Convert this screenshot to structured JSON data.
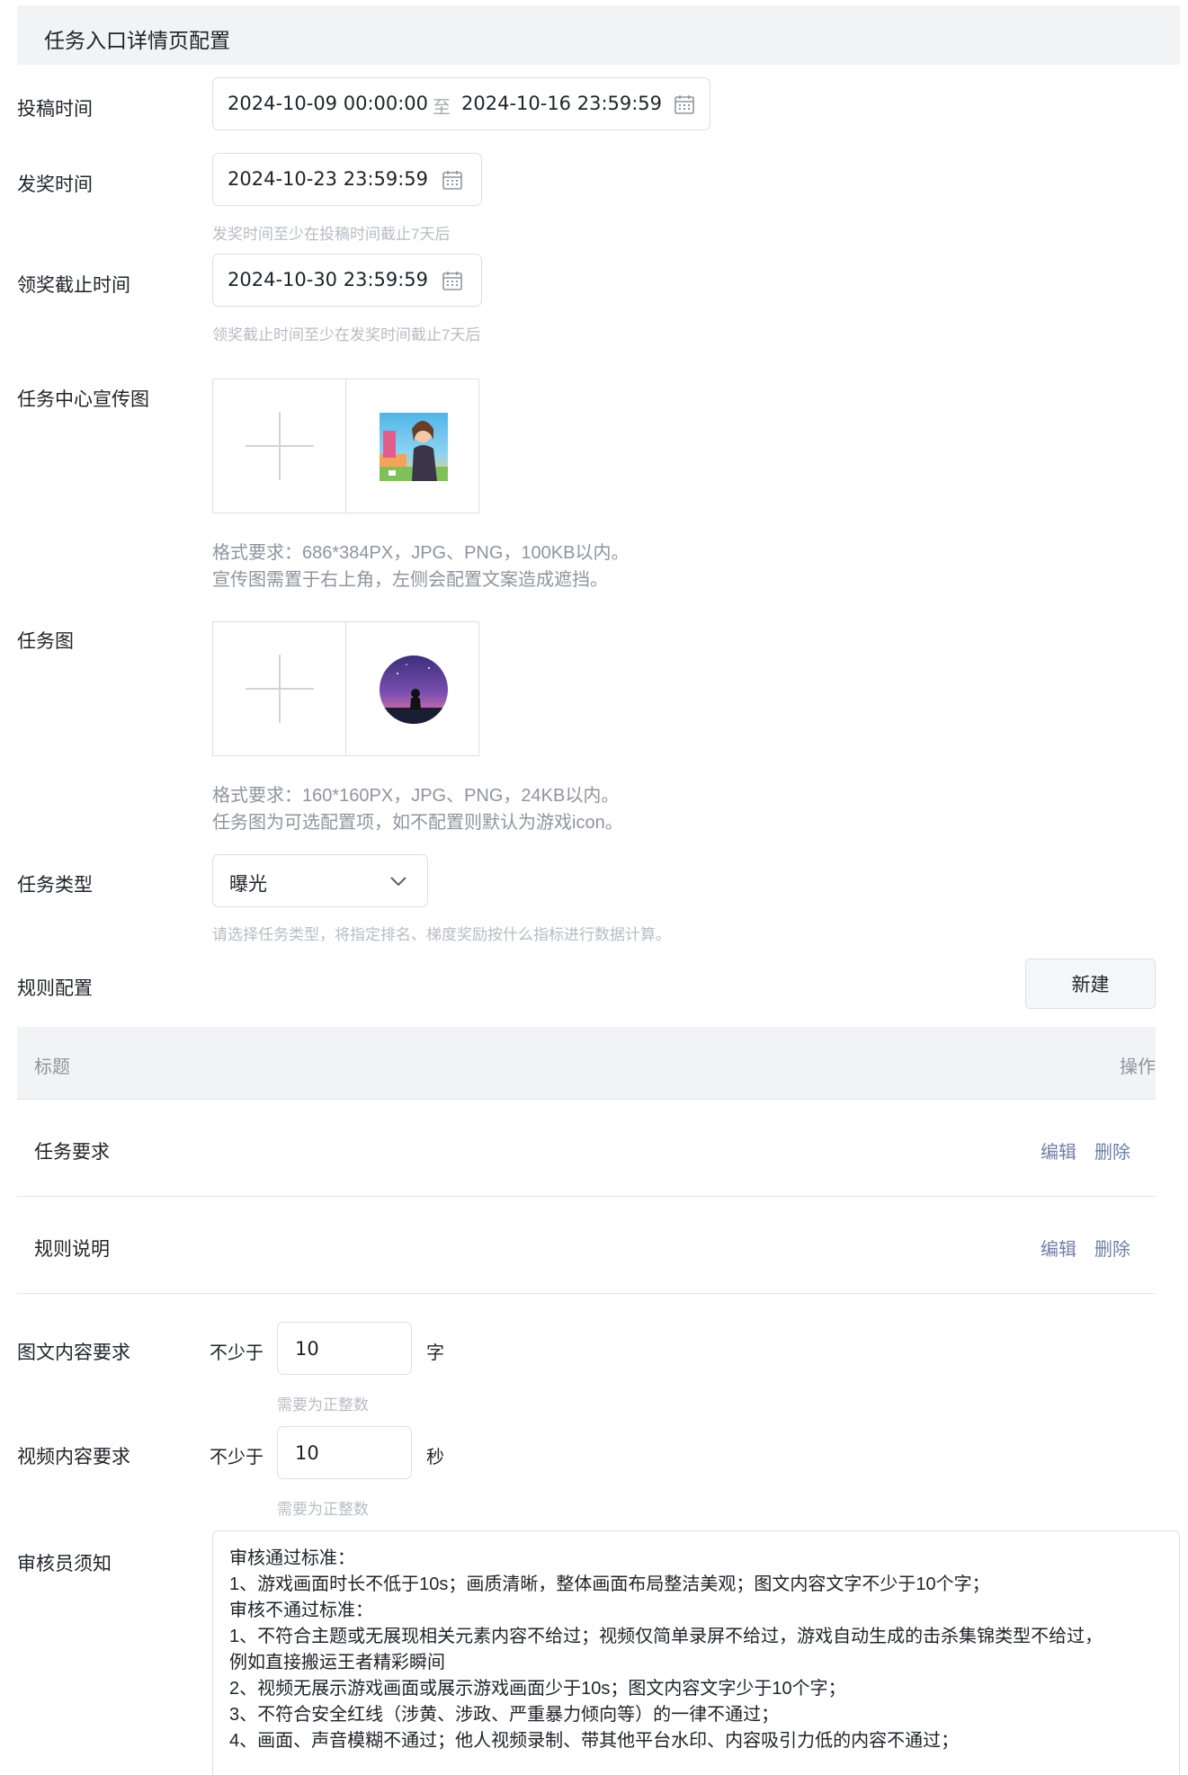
{
  "header": {
    "title": "任务入口详情页配置"
  },
  "submit_time": {
    "label": "投稿时间",
    "start": "2024-10-09 00:00:00",
    "separator": "至",
    "end": "2024-10-16 23:59:59",
    "icon": "calendar-icon"
  },
  "award_time": {
    "label": "发奖时间",
    "value": "2024-10-23 23:59:59",
    "hint": "发奖时间至少在投稿时间截止7天后",
    "icon": "calendar-icon"
  },
  "claim_deadline": {
    "label": "领奖截止时间",
    "value": "2024-10-30 23:59:59",
    "hint": "领奖截止时间至少在发奖时间截止7天后",
    "icon": "calendar-icon"
  },
  "banner": {
    "label": "任务中心宣传图",
    "hint_line1": "格式要求：686*384PX，JPG、PNG，100KB以内。",
    "hint_line2": "宣传图需置于右上角，左侧会配置文案造成遮挡。",
    "icon": "plus-icon"
  },
  "task_image": {
    "label": "任务图",
    "hint_line1": "格式要求：160*160PX，JPG、PNG，24KB以内。",
    "hint_line2": "任务图为可选配置项，如不配置则默认为游戏icon。",
    "icon": "plus-icon"
  },
  "task_type": {
    "label": "任务类型",
    "value": "曝光",
    "hint": "请选择任务类型，将指定排名、梯度奖励按什么指标进行数据计算。",
    "icon": "chevron-down-icon"
  },
  "rules": {
    "label": "规则配置",
    "new_button": "新建",
    "columns": {
      "title": "标题",
      "action": "操作"
    },
    "rows": [
      {
        "title": "任务要求",
        "edit": "编辑",
        "delete": "删除"
      },
      {
        "title": "规则说明",
        "edit": "编辑",
        "delete": "删除"
      }
    ]
  },
  "text_content": {
    "label": "图文内容要求",
    "prefix": "不少于",
    "value": "10",
    "unit": "字",
    "hint": "需要为正整数"
  },
  "video_content": {
    "label": "视频内容要求",
    "prefix": "不少于",
    "value": "10",
    "unit": "秒",
    "hint": "需要为正整数"
  },
  "reviewer": {
    "label": "审核员须知",
    "lines": [
      "审核通过标准：",
      "1、游戏画面时长不低于10s；画质清晰，整体画面布局整洁美观；图文内容文字不少于10个字；",
      "审核不通过标准：",
      "1、不符合主题或无展现相关元素内容不给过；视频仅简单录屏不给过，游戏自动生成的击杀集锦类型不给过，",
      "例如直接搬运王者精彩瞬间",
      "2、视频无展示游戏画面或展示游戏画面少于10s；图文内容文字少于10个字；",
      "3、不符合安全红线（涉黄、涉政、严重暴力倾向等）的一律不通过；",
      "4、画面、声音模糊不通过；他人视频录制、带其他平台水印、内容吸引力低的内容不通过；"
    ]
  }
}
